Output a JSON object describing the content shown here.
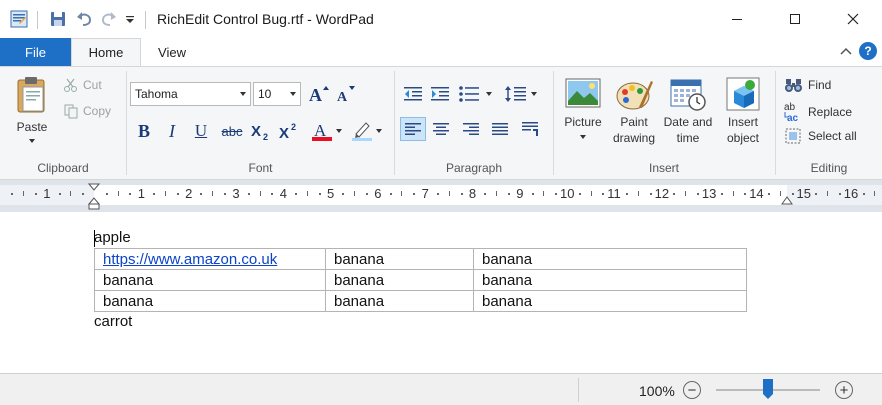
{
  "window": {
    "title": "RichEdit Control Bug.rtf - WordPad"
  },
  "tabs": {
    "file": "File",
    "home": "Home",
    "view": "View"
  },
  "clipboard": {
    "paste": "Paste",
    "cut": "Cut",
    "copy": "Copy",
    "label": "Clipboard"
  },
  "font": {
    "family": "Tahoma",
    "size": "10",
    "label": "Font",
    "bold": "B",
    "italic": "I",
    "underline": "U",
    "strikethrough": "abc",
    "font_color": "#e81123",
    "highlight_color": "#a8d7ff"
  },
  "paragraph": {
    "label": "Paragraph"
  },
  "insert": {
    "picture": "Picture",
    "paint_drawing": [
      "Paint",
      "drawing"
    ],
    "date_time": [
      "Date and",
      "time"
    ],
    "insert_object": [
      "Insert",
      "object"
    ],
    "label": "Insert"
  },
  "editing": {
    "find": "Find",
    "replace": "Replace",
    "select_all": "Select all",
    "label": "Editing"
  },
  "ruler": {
    "numbers": [
      "1",
      "1",
      "2",
      "3",
      "4",
      "5",
      "6",
      "7",
      "8",
      "9",
      "10",
      "11",
      "12",
      "13",
      "14",
      "15",
      "16"
    ]
  },
  "document": {
    "line1": "apple",
    "table": [
      [
        "https://www.amazon.co.uk",
        "banana",
        "banana"
      ],
      [
        "banana",
        "banana",
        "banana"
      ],
      [
        "banana",
        "banana",
        "banana"
      ]
    ],
    "line2": "carrot"
  },
  "status": {
    "zoom": "100%",
    "zoom_level": 0.5
  },
  "colors": {
    "accent": "#1e6fc6",
    "link": "#0b44c8"
  }
}
